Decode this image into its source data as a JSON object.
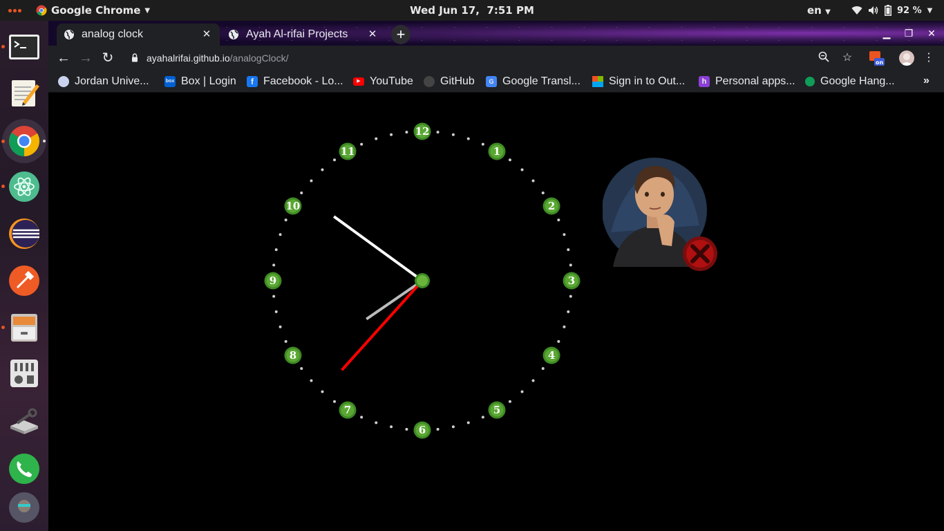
{
  "topbar": {
    "app_name": "Google Chrome",
    "datetime": "Wed Jun 17,  7:51 PM",
    "language": "en",
    "battery": "92 %"
  },
  "dock": {
    "items": [
      {
        "name": "terminal",
        "running": true
      },
      {
        "name": "text-editor",
        "running": false
      },
      {
        "name": "chrome",
        "running": true
      },
      {
        "name": "atom",
        "running": true
      },
      {
        "name": "eclipse",
        "running": false
      },
      {
        "name": "postman",
        "running": false
      },
      {
        "name": "file-cabinet",
        "running": true
      },
      {
        "name": "mixer",
        "running": false
      },
      {
        "name": "system-tools",
        "running": false
      },
      {
        "name": "whatsapp",
        "running": false
      },
      {
        "name": "user-avatar",
        "running": false
      }
    ]
  },
  "tabs": [
    {
      "title": "analog clock",
      "active": true
    },
    {
      "title": "Ayah Al-rifai Projects",
      "active": false
    }
  ],
  "address": {
    "host": "ayahalrifai.github.io",
    "path": "/analogClock/"
  },
  "bookmarks": [
    {
      "label": "Jordan Unive...",
      "icon_color": "#c9d3ef"
    },
    {
      "label": "Box | Login",
      "icon_color": "#0061d5"
    },
    {
      "label": "Facebook - Lo...",
      "icon_color": "#1877f2"
    },
    {
      "label": "YouTube",
      "icon_color": "#ff0000"
    },
    {
      "label": "GitHub",
      "icon_color": "#444444"
    },
    {
      "label": "Google Transl...",
      "icon_color": "#4285f4"
    },
    {
      "label": "Sign in to Out...",
      "icon_color": "#f25022"
    },
    {
      "label": "Personal apps...",
      "icon_color": "#8b3fd6"
    },
    {
      "label": "Google Hang...",
      "icon_color": "#0f9d58"
    }
  ],
  "clock": {
    "numerals": [
      "12",
      "1",
      "2",
      "3",
      "4",
      "5",
      "6",
      "7",
      "8",
      "9",
      "10",
      "11"
    ],
    "time_shown": "7:51",
    "hour_value": 7.85,
    "minute_value": 51,
    "second_value": 37,
    "hand_colors": {
      "hour": "#bbbbbb",
      "minute": "#ffffff",
      "second": "#ff0000"
    },
    "marker_color": "#5aa833"
  }
}
